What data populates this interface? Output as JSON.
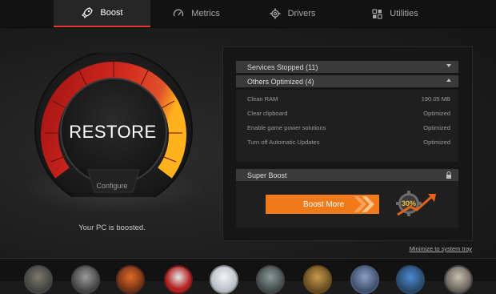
{
  "nav": {
    "tabs": [
      {
        "label": "Boost",
        "icon": "rocket-icon"
      },
      {
        "label": "Metrics",
        "icon": "speedometer-icon"
      },
      {
        "label": "Drivers",
        "icon": "gear-icon"
      },
      {
        "label": "Utilities",
        "icon": "grid-icon"
      }
    ],
    "active_tab": "Boost"
  },
  "gauge": {
    "button_label": "RESTORE",
    "configure_label": "Configure",
    "status_text": "Your PC is boosted."
  },
  "panel": {
    "services_stopped": "Services Stopped (11)",
    "others_optimized": "Others Optimized (4)",
    "items": [
      {
        "name": "Clean RAM",
        "value": "190.05 MB"
      },
      {
        "name": "Clear clipboard",
        "value": "Optimized"
      },
      {
        "name": "Enable game power solutions",
        "value": "Optimized"
      },
      {
        "name": "Turn off Automatic Updates",
        "value": "Optimized"
      }
    ],
    "super_boost": "Super Boost",
    "boost_more": "Boost More",
    "badge_text": "30%"
  },
  "footer": {
    "minimize_link": "Minimize to system tray"
  },
  "colors": {
    "accent_red": "#e23b2b",
    "accent_orange": "#f07a1a"
  },
  "games": [
    "game-icon-1",
    "game-icon-2",
    "game-icon-3",
    "game-icon-4",
    "game-icon-5",
    "game-icon-6",
    "game-icon-7",
    "game-icon-8",
    "game-icon-9",
    "game-icon-10"
  ]
}
